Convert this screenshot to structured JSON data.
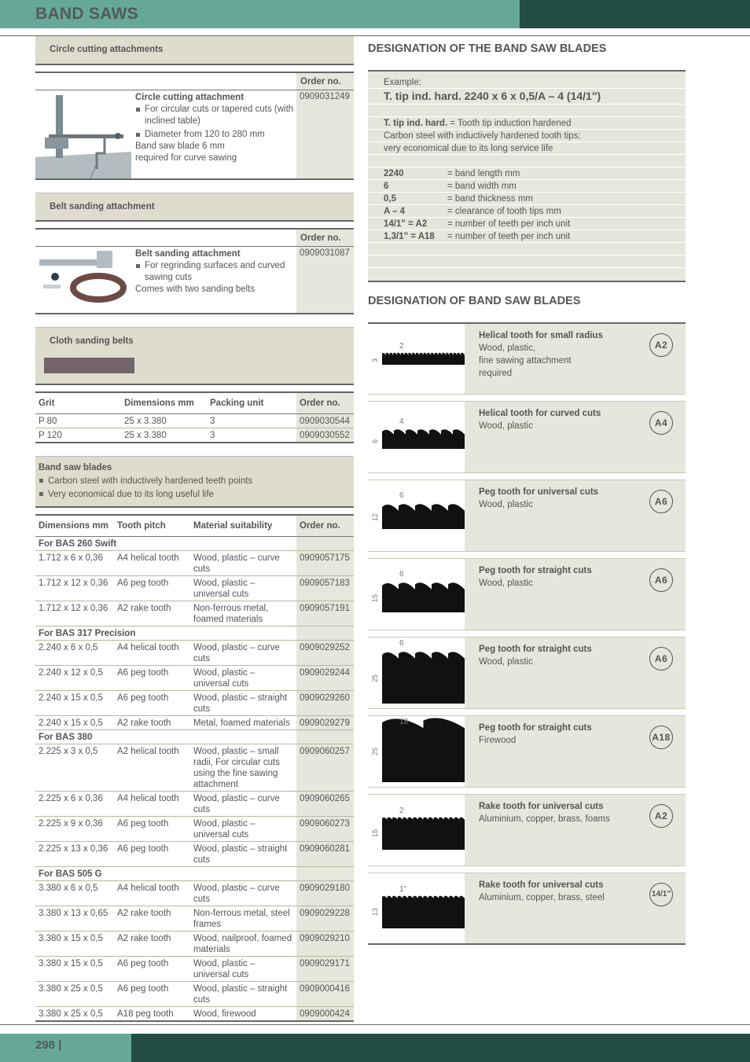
{
  "header": {
    "title": "BAND SAWS"
  },
  "footer": {
    "page": "298 |"
  },
  "colors": {
    "header_light": "#65a898",
    "header_dark": "#234c44",
    "panel": "#deddcd",
    "order_col": "#e7e6dc"
  },
  "circle": {
    "section_title": "Circle cutting attachments",
    "order_header": "Order no.",
    "product_name": "Circle cutting attachment",
    "bullets": [
      "For circular cuts or tapered cuts (with inclined table)",
      "Diameter from 120 to 280 mm"
    ],
    "note": "Band saw blade 6 mm required for curve sawing",
    "order_no": "0909031249"
  },
  "belt": {
    "section_title": "Belt sanding attachment",
    "order_header": "Order no.",
    "product_name": "Belt sanding attachment",
    "bullets": [
      "For regrinding surfaces and curved sawing cuts"
    ],
    "note": "Comes with two sanding belts",
    "order_no": "0909031087"
  },
  "cloth": {
    "section_title": "Cloth sanding belts",
    "headers": [
      "Grit",
      "Dimensions mm",
      "Packing unit",
      "Order no."
    ],
    "rows": [
      [
        "P 80",
        "25 x 3.380",
        "3",
        "0909030544"
      ],
      [
        "P 120",
        "25 x 3.380",
        "3",
        "0909030552"
      ]
    ]
  },
  "blades": {
    "section_title": "Band saw blades",
    "bullets": [
      "Carbon steel with inductively hardened teeth points",
      "Very economical due to its long useful life"
    ],
    "headers": [
      "Dimensions mm",
      "Tooth pitch",
      "Material suitability",
      "Order no."
    ],
    "groups": [
      {
        "name": "For BAS 260 Swift",
        "rows": [
          [
            "1.712 x 6 x 0,36",
            "A4 helical tooth",
            "Wood, plastic – curve cuts",
            "0909057175"
          ],
          [
            "1.712 x 12 x 0,36",
            "A6 peg tooth",
            "Wood, plastic – universal cuts",
            "0909057183"
          ],
          [
            "1.712 x 12 x 0,36",
            "A2 rake tooth",
            "Non-ferrous metal, foamed materials",
            "0909057191"
          ]
        ]
      },
      {
        "name": "For BAS 317 Precision",
        "rows": [
          [
            "2.240 x 6 x 0,5",
            "A4 helical tooth",
            "Wood, plastic – curve cuts",
            "0909029252"
          ],
          [
            "2.240 x 12 x 0,5",
            "A6 peg tooth",
            "Wood, plastic – universal cuts",
            "0909029244"
          ],
          [
            "2.240 x 15 x 0,5",
            "A6 peg tooth",
            "Wood, plastic – straight cuts",
            "0909029260"
          ],
          [
            "2.240 x 15 x 0,5",
            "A2 rake tooth",
            "Metal, foamed materials",
            "0909029279"
          ]
        ]
      },
      {
        "name": "For BAS 380",
        "rows": [
          [
            "2.225 x 3 x 0,5",
            "A2 helical tooth",
            "Wood, plastic – small radii, For circular cuts using the fine sawing attachment",
            "0909060257"
          ],
          [
            "2.225 x 6 x 0,36",
            "A4 helical tooth",
            "Wood, plastic – curve cuts",
            "0909060265"
          ],
          [
            "2.225 x 9 x 0,36",
            "A6 peg tooth",
            "Wood, plastic – universal cuts",
            "0909060273"
          ],
          [
            "2.225 x 13 x 0,36",
            "A6 peg tooth",
            "Wood, plastic – straight cuts",
            "0909060281"
          ]
        ]
      },
      {
        "name": "For BAS 505 G",
        "rows": [
          [
            "3.380 x 6 x 0,5",
            "A4 helical tooth",
            "Wood, plastic – curve cuts",
            "0909029180"
          ],
          [
            "3.380 x 13 x 0,65",
            "A2 rake tooth",
            "Non-ferrous metal, steel frames",
            "0909029228"
          ],
          [
            "3.380 x 15 x 0,5",
            "A2 rake tooth",
            "Wood, nailproof, foamed materials",
            "0909029210"
          ],
          [
            "3.380 x 15 x 0,5",
            "A6 peg tooth",
            "Wood, plastic – universal cuts",
            "0909029171"
          ],
          [
            "3.380 x 25 x 0,5",
            "A6 peg tooth",
            "Wood, plastic – straight cuts",
            "0909000416"
          ],
          [
            "3.380 x 25 x 0,5",
            "A18 peg tooth",
            "Wood, firewood",
            "0909000424"
          ]
        ]
      }
    ]
  },
  "designation": {
    "title": "DESIGNATION OF THE BAND SAW BLADES",
    "example_label": "Example:",
    "example_value": "T. tip ind. hard. 2240 x 6 x 0,5/A – 4 (14/1\")",
    "abbr": "T. tip ind. hard.",
    "abbr_text": " = Tooth tip induction hardened",
    "desc1": "Carbon steel with inductively hardened tooth tips;",
    "desc2": "very economical due to its long service life",
    "keys": [
      {
        "k": "2240",
        "v": "= band length mm"
      },
      {
        "k": "6",
        "v": "= band width mm"
      },
      {
        "k": "0,5",
        "v": "= band thickness mm"
      },
      {
        "k": "A – 4",
        "v": "= clearance of tooth tips mm"
      },
      {
        "k": "14/1\" = A2",
        "v": "= number of teeth per inch unit"
      },
      {
        "k": "1,3/1\" = A18",
        "v": "= number of teeth per inch unit"
      }
    ]
  },
  "blade_types": {
    "title": "DESIGNATION OF BAND SAW BLADES",
    "items": [
      {
        "name": "Helical tooth for small radius",
        "desc": [
          "Wood, plastic,",
          "fine sawing attachment",
          "required"
        ],
        "badge": "A2",
        "pitch_label": "2",
        "height_label": "3"
      },
      {
        "name": "Helical tooth for curved cuts",
        "desc": [
          "Wood, plastic"
        ],
        "badge": "A4",
        "pitch_label": "4",
        "height_label": "6"
      },
      {
        "name": "Peg tooth for universal cuts",
        "desc": [
          "Wood, plastic"
        ],
        "badge": "A6",
        "pitch_label": "6",
        "height_label": "12"
      },
      {
        "name": "Peg tooth for straight cuts",
        "desc": [
          "Wood, plastic"
        ],
        "badge": "A6",
        "pitch_label": "6",
        "height_label": "15"
      },
      {
        "name": "Peg tooth for straight cuts",
        "desc": [
          "Wood, plastic"
        ],
        "badge": "A6",
        "pitch_label": "6",
        "height_label": "25"
      },
      {
        "name": "Peg tooth for straight cuts",
        "desc": [
          "Firewood"
        ],
        "badge": "A18",
        "pitch_label": "18",
        "height_label": "25"
      },
      {
        "name": "Rake tooth for universal cuts",
        "desc": [
          "Aluminium, copper, brass, foams"
        ],
        "badge": "A2",
        "pitch_label": "2",
        "height_label": "15"
      },
      {
        "name": "Rake tooth for universal cuts",
        "desc": [
          "Aluminium, copper, brass, steel"
        ],
        "badge": "14/1\"",
        "pitch_label": "1\"",
        "height_label": "13"
      }
    ]
  }
}
